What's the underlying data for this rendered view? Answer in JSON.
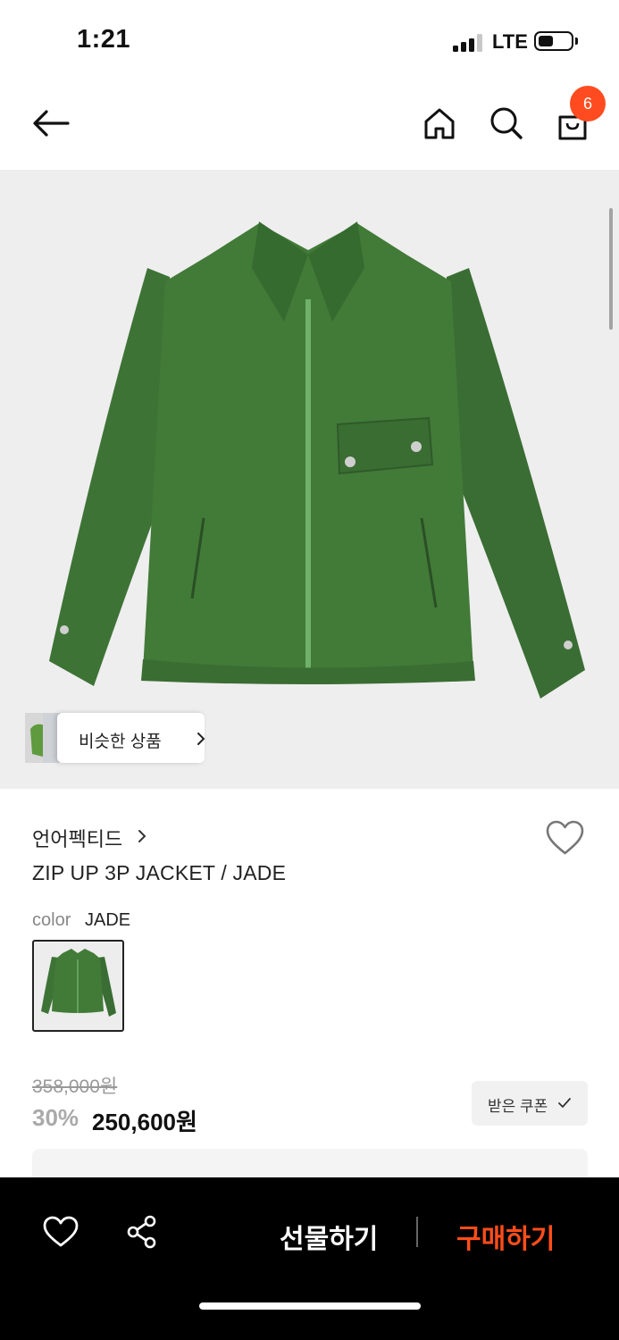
{
  "status_bar": {
    "time": "1:21",
    "network": "LTE"
  },
  "header": {
    "back_icon": "arrow-left-icon",
    "home_icon": "home-icon",
    "search_icon": "search-icon",
    "bag_icon": "shopping-bag-icon",
    "cart_count": "6"
  },
  "hero": {
    "similar_label": "비슷한 상품"
  },
  "product": {
    "brand": "언어펙티드",
    "name": "ZIP UP 3P JACKET / JADE",
    "color_label": "color",
    "color_value": "JADE",
    "original_price": "358,000원",
    "discount": "30%",
    "final_price": "250,600원",
    "coupon_label": "받은 쿠폰"
  },
  "bottom_bar": {
    "gift_label": "선물하기",
    "buy_label": "구매하기"
  },
  "colors": {
    "accent": "#ff4b1f",
    "buy": "#ff4d1a",
    "jacket": "#3e7336"
  }
}
